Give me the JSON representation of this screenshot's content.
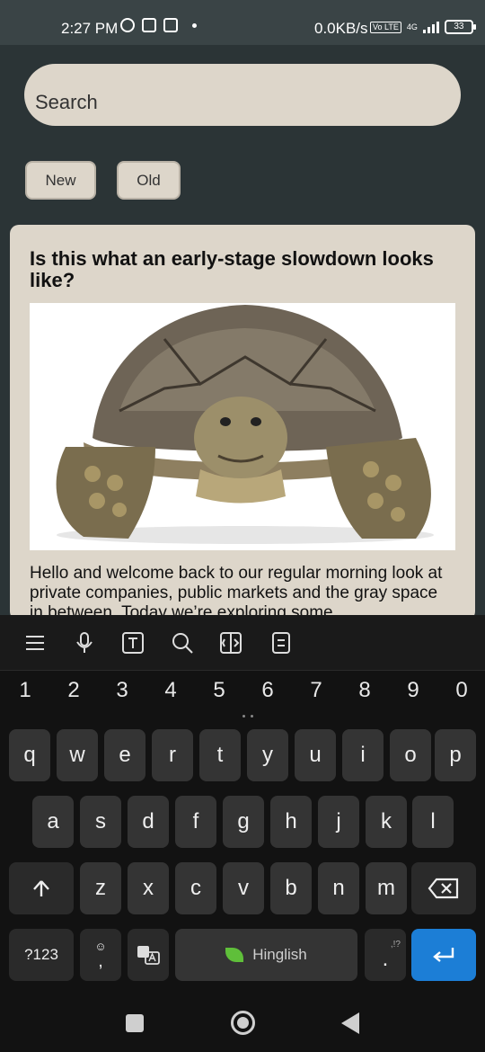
{
  "status_bar": {
    "time": "2:27 PM",
    "network_speed": "0.0KB/s",
    "network_badge": "Vo LTE",
    "network_type": "4G",
    "battery": "33",
    "icons": [
      "whatsapp-icon",
      "app-icon",
      "calendar-icon",
      "dot-icon",
      "signal-icon",
      "battery-icon"
    ]
  },
  "search": {
    "placeholder": "Search"
  },
  "filters": {
    "new_label": "New",
    "old_label": "Old"
  },
  "article": {
    "title": "Is this what an early-stage slowdown looks like?",
    "image_subject": "tortoise",
    "body": "Hello and welcome back to our regular morning look at private companies, public markets and the gray space in between. Today we’re exploring some"
  },
  "keyboard": {
    "toolbar_icons": [
      "menu-icon",
      "mic-icon",
      "text-icon",
      "search-icon",
      "translate-icon",
      "clipboard-icon"
    ],
    "number_row": [
      "1",
      "2",
      "3",
      "4",
      "5",
      "6",
      "7",
      "8",
      "9",
      "0"
    ],
    "row1": [
      "q",
      "w",
      "e",
      "r",
      "t",
      "y",
      "u",
      "i",
      "o",
      "p"
    ],
    "row2": [
      "a",
      "s",
      "d",
      "f",
      "g",
      "h",
      "j",
      "k",
      "l"
    ],
    "row3": [
      "z",
      "x",
      "c",
      "v",
      "b",
      "n",
      "m"
    ],
    "symbols_label": "?123",
    "comma_label": ",",
    "space_label": "Hinglish",
    "period_label": ".",
    "period_alt": ",!?"
  },
  "colors": {
    "background": "#2b3436",
    "card": "#ddd6ca",
    "keyboard": "#121212",
    "enter_key": "#1c7ed6"
  }
}
